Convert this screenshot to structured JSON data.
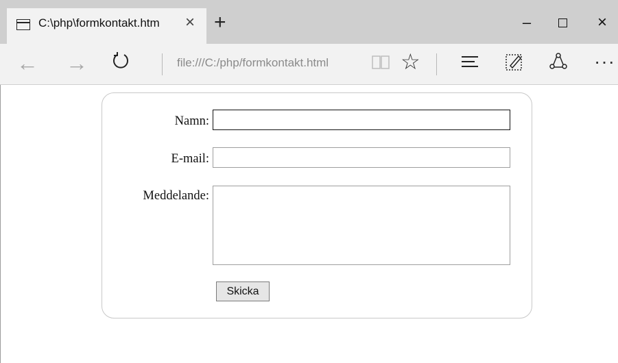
{
  "browser": {
    "tab_title": "C:\\php\\formkontakt.htm",
    "address": "file:///C:/php/formkontakt.html",
    "icons": {
      "tab": "page-icon",
      "close_tab": "close-icon",
      "new_tab": "plus-icon",
      "back": "arrow-left-icon",
      "forward": "arrow-right-icon",
      "refresh": "refresh-icon",
      "reading_view": "book-icon",
      "favorite": "star-icon",
      "hub": "hub-icon",
      "web_note": "pen-note-icon",
      "share": "share-icon",
      "more": "more-icon"
    },
    "window_controls": {
      "minimize": "–",
      "maximize": "□",
      "close": "×"
    }
  },
  "form": {
    "name_label": "Namn:",
    "email_label": "E-mail:",
    "message_label": "Meddelande:",
    "name_value": "",
    "email_value": "",
    "message_value": "",
    "submit_label": "Skicka"
  }
}
